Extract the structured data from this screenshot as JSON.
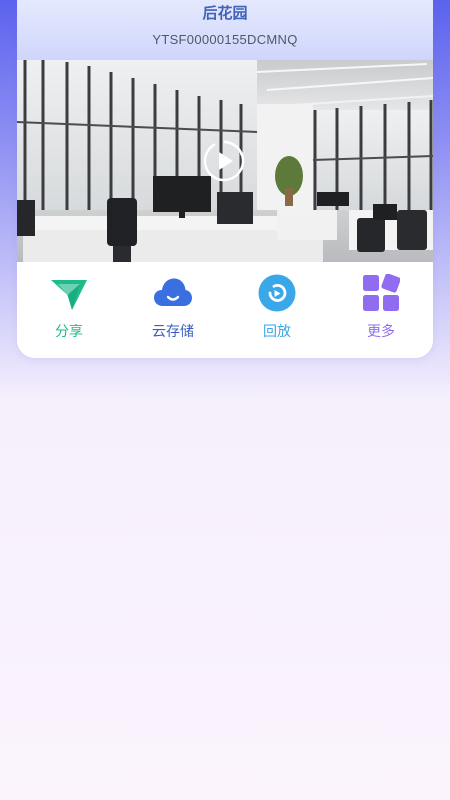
{
  "device": {
    "name": "后花园",
    "serial": "YTSF00000155DCMNQ"
  },
  "actions": [
    {
      "label": "分享",
      "icon": "send-icon",
      "color": "#1fbb8c"
    },
    {
      "label": "云存储",
      "icon": "cloud-icon",
      "color": "#3a6fe0"
    },
    {
      "label": "回放",
      "icon": "replay-icon",
      "color": "#3aa7e8"
    },
    {
      "label": "更多",
      "icon": "grid-more-icon",
      "color": "#8f6cf0"
    }
  ],
  "colors": {
    "title": "#3f63b8",
    "background_top": "#5b63ee",
    "background_bottom": "#fbf4fd"
  }
}
